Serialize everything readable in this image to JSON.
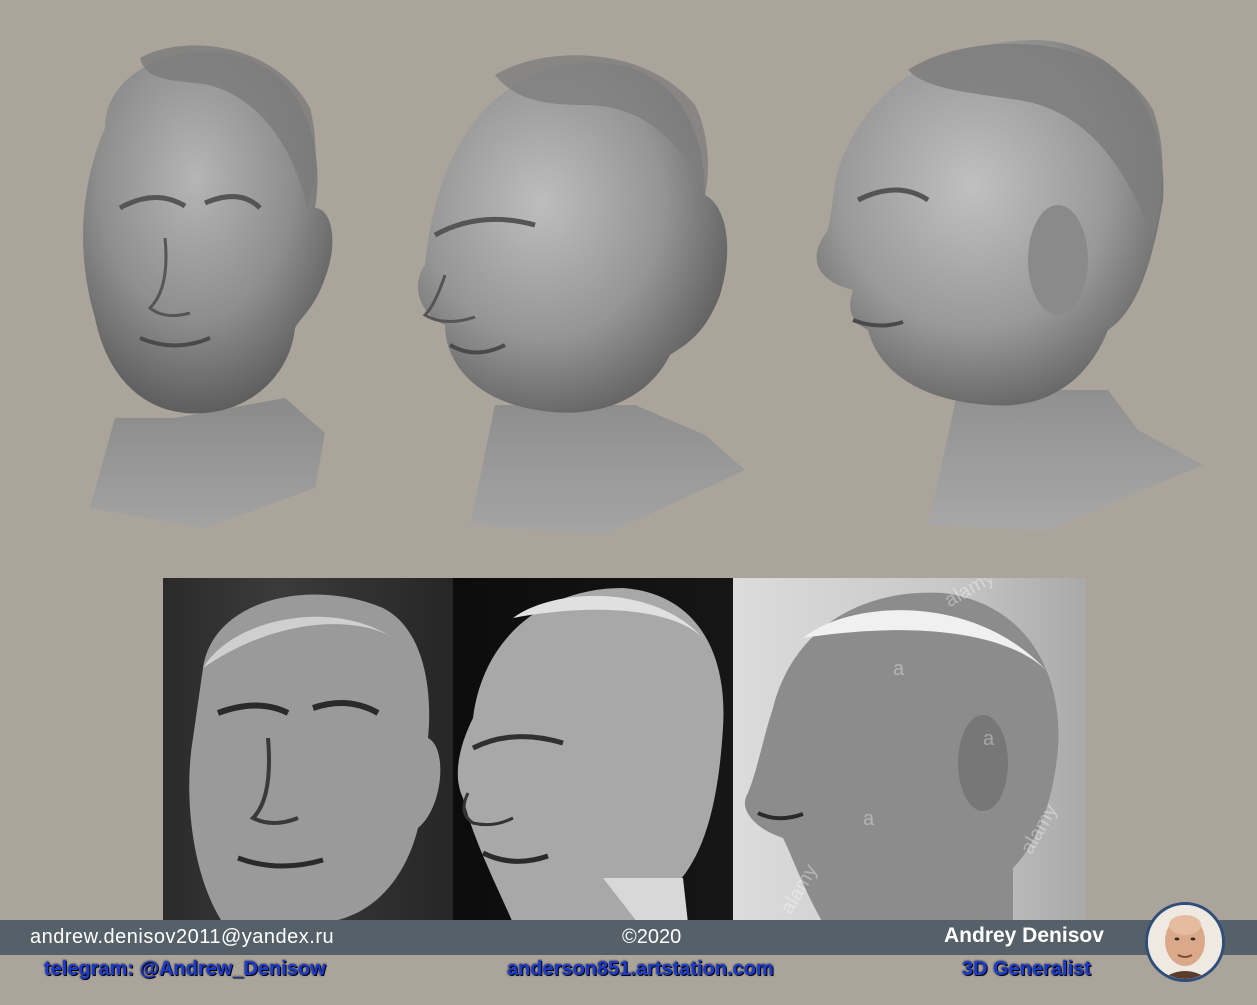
{
  "watermark_text": "alamy",
  "watermark_mark": "a",
  "footer": {
    "email": "andrew.denisov2011@yandex.ru",
    "copyright": "©2020",
    "author": "Andrey Denisov",
    "telegram": "telegram: @Andrew_Denisow",
    "site": "anderson851.artstation.com",
    "role": "3D Generalist"
  },
  "colors": {
    "background": "#aaa49b",
    "footer_bar": "#566068",
    "link_blue": "#1a3ad0",
    "avatar_border": "#2f4e7a"
  }
}
